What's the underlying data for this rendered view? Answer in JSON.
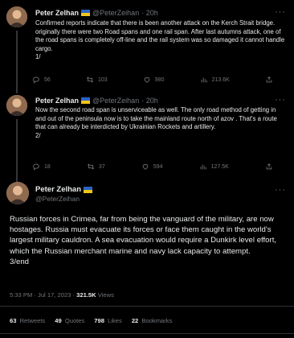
{
  "tweets": [
    {
      "name": "Peter Zelhan",
      "handle": "@PeterZeihan",
      "time": "· 20h",
      "text": "Confirmed reports indicate that there is been another attack on the Kerch Strait bridge. originally there were two Road spans and one rail span. After last autumns attack, one of the road spans is completely off-line and the rail system was so damaged it cannot handle cargo.\n1/",
      "replies": "56",
      "retweets": "103",
      "likes": "980",
      "views": "213.6K"
    },
    {
      "name": "Peter Zelhan",
      "handle": "@PeterZeihan",
      "time": "· 20h",
      "text": "Now the second road span is unserviceable as well. The only road method of getting in and out of the peninsula now is to take the mainland route north of azov . That's a route that can already be interdicted by Ukrainian Rockets and artillery.\n2/",
      "replies": "18",
      "retweets": "37",
      "likes": "594",
      "views": "127.5K"
    }
  ],
  "main_tweet": {
    "name": "Peter Zelhan",
    "handle": "@PeterZeihan",
    "text": "Russian forces in Crimea, far from being the vanguard of the military, are now hostages. Russia must evacuate its forces or face them caught in the world's largest military cauldron. A sea  evacuation would require a Dunkirk level effort, which the Russian merchant marine and navy lack capacity to attempt.\n3/end",
    "timestamp": "5:33 PM · Jul 17, 2023 · ",
    "views_count": "321.5K",
    "views_label": " Views",
    "stats": {
      "retweets_count": "63",
      "retweets_label": "Retweets",
      "quotes_count": "49",
      "quotes_label": "Quotes",
      "likes_count": "798",
      "likes_label": "Likes",
      "bookmarks_count": "22",
      "bookmarks_label": "Bookmarks"
    }
  },
  "more_label": "···",
  "icons": {
    "reply": "reply-icon",
    "retweet": "retweet-icon",
    "like": "heart-icon",
    "views": "views-icon",
    "share": "share-icon"
  }
}
